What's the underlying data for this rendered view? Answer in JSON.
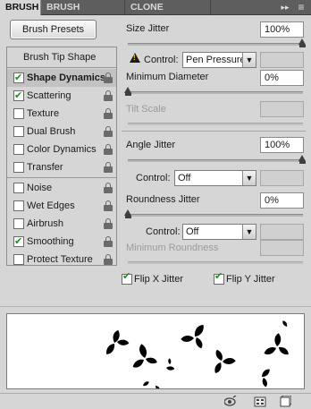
{
  "tabs": [
    {
      "label": "BRUSH",
      "active": true
    },
    {
      "label": "BRUSH PRESETS",
      "active": false
    },
    {
      "label": "CLONE SOURCE",
      "active": false
    }
  ],
  "panel_menu": {
    "collapse": "▸▸",
    "menu": "≡"
  },
  "presets_button": "Brush Presets",
  "list_header": "Brush Tip Shape",
  "options": [
    {
      "label": "Shape Dynamics",
      "checked": true,
      "selected": true
    },
    {
      "label": "Scattering",
      "checked": true
    },
    {
      "label": "Texture",
      "checked": false
    },
    {
      "label": "Dual Brush",
      "checked": false
    },
    {
      "label": "Color Dynamics",
      "checked": false
    },
    {
      "label": "Transfer",
      "checked": false
    },
    {
      "label": "Noise",
      "checked": false
    },
    {
      "label": "Wet Edges",
      "checked": false
    },
    {
      "label": "Airbrush",
      "checked": false
    },
    {
      "label": "Smoothing",
      "checked": true
    },
    {
      "label": "Protect Texture",
      "checked": false
    }
  ],
  "size_jitter": {
    "label": "Size Jitter",
    "value": "100%",
    "slider": 1.0
  },
  "size_control": {
    "label": "Control:",
    "value": "Pen Pressure"
  },
  "min_diameter": {
    "label": "Minimum Diameter",
    "value": "0%",
    "slider": 0.0
  },
  "tilt_scale": {
    "label": "Tilt Scale",
    "value": ""
  },
  "angle_jitter": {
    "label": "Angle Jitter",
    "value": "100%",
    "slider": 1.0
  },
  "angle_control": {
    "label": "Control:",
    "value": "Off"
  },
  "roundness_jitter": {
    "label": "Roundness Jitter",
    "value": "0%",
    "slider": 0.0
  },
  "roundness_control": {
    "label": "Control:",
    "value": "Off"
  },
  "min_roundness": {
    "label": "Minimum Roundness",
    "value": ""
  },
  "flip_x": {
    "label": "Flip X Jitter",
    "checked": true
  },
  "flip_y": {
    "label": "Flip Y Jitter",
    "checked": true
  },
  "colors": {
    "panel_bg": "#d6d6d6",
    "tabbar_bg": "#5e5e5e",
    "check_green": "#1f8a1f"
  }
}
